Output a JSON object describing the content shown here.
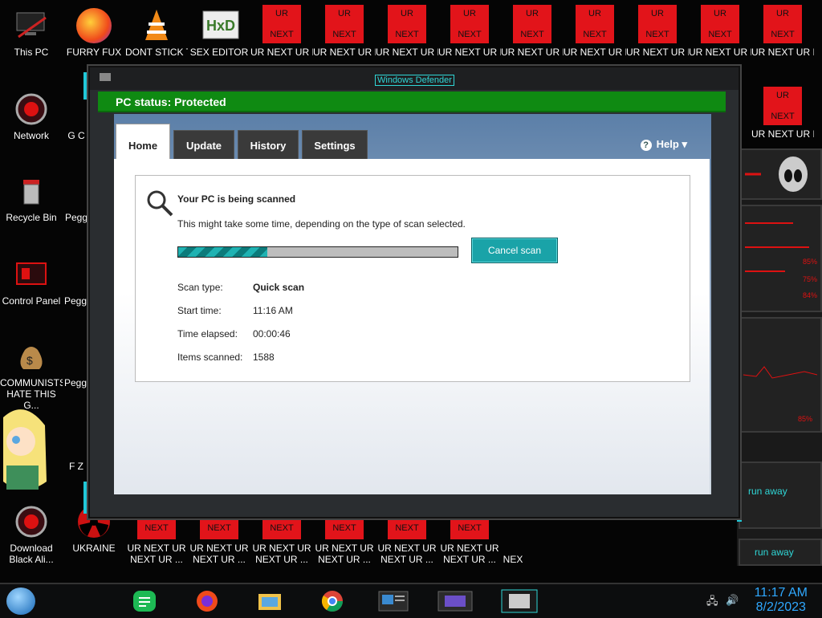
{
  "desktop": {
    "left_column": [
      {
        "label": "This PC",
        "icon": "computer-icon"
      },
      {
        "label": "Network",
        "icon": "network-globe-icon"
      },
      {
        "label": "Recycle Bin",
        "icon": "recycle-bin-icon"
      },
      {
        "label": "Control Panel",
        "icon": "control-panel-icon"
      },
      {
        "label": "COMMUNISTS HATE THIS G...",
        "icon": "money-bag-icon"
      },
      {
        "label": "Download Black Ali...",
        "icon": "alien-globe-icon"
      }
    ],
    "top_row": [
      {
        "label": "FURRY FUX",
        "icon": "firefox-icon"
      },
      {
        "label": "DONT STICK THIS IN YO...",
        "icon": "vlc-cone-icon"
      },
      {
        "label": "SEX EDITOR",
        "icon": "hxd-icon"
      }
    ],
    "ur_tile": {
      "top": "UR",
      "bottom": "NEXT",
      "label": "UR NEXT UR NEXT UR ..."
    },
    "next_tile": {
      "text": "NEXT",
      "label": "UR NEXT UR NEXT UR ..."
    },
    "partial_labels": {
      "second_column": [
        "G C",
        "Pegg",
        "Pegg D",
        "Pegg of W",
        "F Z"
      ],
      "truncated": "NEX"
    },
    "ukraine_label": "UKRAINE"
  },
  "sidebar": {
    "run_away_1": "run away",
    "run_away_2": "run away",
    "stats": [
      "85%",
      "75%",
      "84%",
      "85%"
    ]
  },
  "window": {
    "title": "Windows Defender",
    "status": "PC status: Protected",
    "tabs": [
      "Home",
      "Update",
      "History",
      "Settings"
    ],
    "active_tab": "Home",
    "help": "Help",
    "scan": {
      "heading": "Your PC is being scanned",
      "subtext": "This might take some time, depending on the type of scan selected.",
      "progress": 0.32,
      "cancel_label": "Cancel scan",
      "rows": [
        {
          "label": "Scan type:",
          "value": "Quick scan"
        },
        {
          "label": "Start time:",
          "value": "11:16 AM"
        },
        {
          "label": "Time elapsed:",
          "value": "00:00:46"
        },
        {
          "label": "Items scanned:",
          "value": "1588"
        }
      ]
    }
  },
  "taskbar": {
    "time": "11:17 AM",
    "date": "8/2/2023"
  },
  "colors": {
    "status_green": "#0f8a12",
    "accent_teal": "#1aa3a8",
    "ur_red": "#e2141a",
    "clock_blue": "#2fa8ff"
  }
}
